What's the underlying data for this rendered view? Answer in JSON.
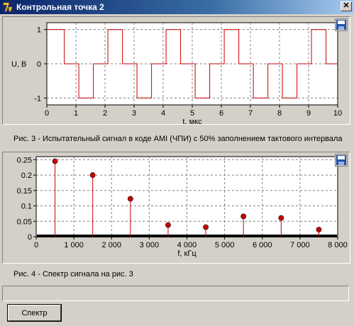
{
  "window": {
    "title": "Контрольная точка 2",
    "close_label": "✕"
  },
  "chart_data": [
    {
      "type": "line",
      "title": "",
      "xlabel": "t, мкс",
      "ylabel": "U, В",
      "xlim": [
        0,
        10
      ],
      "ylim": [
        -1.2,
        1.2
      ],
      "x_ticks": [
        "0",
        "1",
        "2",
        "3",
        "4",
        "5",
        "6",
        "7",
        "8",
        "9",
        "10"
      ],
      "y_ticks": [
        "1",
        "0",
        "-1"
      ],
      "grid": true,
      "series_color": "#cc0000",
      "x": [
        0.0,
        0.1,
        0.1,
        0.6,
        0.6,
        1.0,
        1.0,
        1.1,
        1.1,
        1.6,
        1.6,
        2.0,
        2.0,
        2.1,
        2.1,
        2.6,
        2.6,
        3.0,
        3.0,
        3.1,
        3.1,
        3.6,
        3.6,
        4.0,
        4.0,
        4.1,
        4.1,
        4.6,
        4.6,
        5.0,
        5.0,
        5.1,
        5.1,
        5.6,
        5.6,
        6.0,
        6.0,
        6.1,
        6.1,
        6.6,
        6.6,
        7.0,
        7.0,
        7.1,
        7.1,
        7.6,
        7.6,
        8.0,
        8.0,
        8.1,
        8.1,
        8.6,
        8.6,
        9.0,
        9.0,
        9.1,
        9.1,
        9.6,
        9.6,
        10.0
      ],
      "y": [
        1,
        1,
        1,
        1,
        0,
        0,
        0,
        0,
        -1,
        -1,
        0,
        0,
        0,
        0,
        1,
        1,
        0,
        0,
        0,
        0,
        -1,
        -1,
        0,
        0,
        0,
        0,
        1,
        1,
        0,
        0,
        0,
        0,
        -1,
        -1,
        0,
        0,
        0,
        0,
        1,
        1,
        0,
        0,
        0,
        0,
        -1,
        -1,
        0,
        0,
        0,
        0,
        -1,
        -1,
        0,
        0,
        0,
        0,
        1,
        1,
        0,
        0
      ]
    },
    {
      "type": "stem",
      "title": "",
      "xlabel": "f, кГц",
      "ylabel": "",
      "xlim": [
        0,
        8000
      ],
      "ylim": [
        0,
        0.26
      ],
      "x_ticks": [
        "0",
        "1 000",
        "2 000",
        "3 000",
        "4 000",
        "5 000",
        "6 000",
        "7 000",
        "8 000"
      ],
      "y_ticks": [
        "0.25",
        "0.2",
        "0.15",
        "0.1",
        "0.05",
        "0"
      ],
      "grid": true,
      "series_color": "#cc0000",
      "points": [
        {
          "x": 500,
          "y": 0.245
        },
        {
          "x": 1500,
          "y": 0.2
        },
        {
          "x": 2500,
          "y": 0.123
        },
        {
          "x": 3500,
          "y": 0.038
        },
        {
          "x": 4500,
          "y": 0.031
        },
        {
          "x": 5500,
          "y": 0.066
        },
        {
          "x": 6500,
          "y": 0.061
        },
        {
          "x": 7500,
          "y": 0.023
        }
      ]
    }
  ],
  "captions": {
    "fig3": "Рис. 3 - Испытательный сигнал в коде AMI (ЧПИ) с 50% заполнением тактового интервала",
    "fig4": "Рис. 4 - Спектр сигнала на рис. 3"
  },
  "status_text": "",
  "buttons": {
    "spectrum": "Спектр"
  },
  "icons": {
    "save": "floppy-disk-icon",
    "app": "app-logo-icon"
  }
}
